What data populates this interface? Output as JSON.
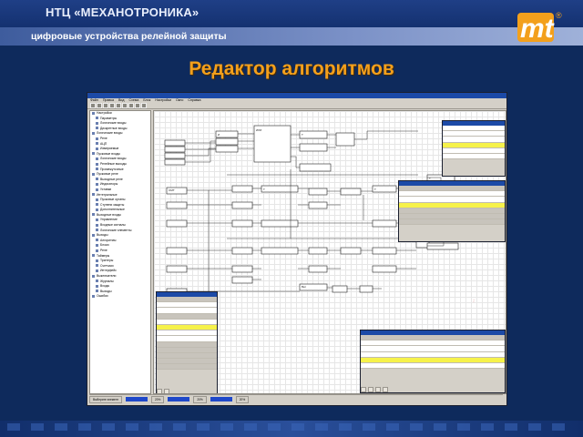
{
  "header": {
    "company": "НТЦ «МЕХАНОТРОНИКА»",
    "subtitle": "цифровые устройства релейной защиты",
    "logo_letters": "mt",
    "registered_mark": "®"
  },
  "slide_title": "Редактор алгоритмов",
  "app": {
    "menu": [
      "Файл",
      "Правка",
      "Вид",
      "Схема",
      "Блок",
      "Настройки",
      "Окно",
      "Справка"
    ],
    "tree_items": [
      "Настройки",
      "Параметры",
      "Логические входы",
      "Дискретные входы",
      "Логические входы",
      "Реле",
      "АЦП",
      "Измеряемые",
      "Пусковые входы",
      "Логические входы",
      "Релейные выходы",
      "Промежуточные",
      "Пусковые реле",
      "Выходные реле",
      "Индикаторы",
      "Уставки",
      "Интегральные",
      "Пусковые органы",
      "Ступени защиты",
      "Дополнительные",
      "Выходные входы",
      "Управление",
      "Входные сигналы",
      "Логические элементы",
      "Выходы",
      "Алгоритмы",
      "Блоки",
      "Реле",
      "Таймеры",
      "Триггеры",
      "Счетчики",
      "Интерфейс",
      "Выключатели",
      "Журналы",
      "Входы",
      "Выходы",
      "Ошибки"
    ],
    "status": {
      "ready_text": "Выберите элемент",
      "progress_a": "20%",
      "progress_b": "20%",
      "progress_c": "20%"
    }
  },
  "colors": {
    "accent_orange": "#f3a01c",
    "title_blue": "#1c4aa7",
    "highlight_yellow": "#f6f24a"
  }
}
